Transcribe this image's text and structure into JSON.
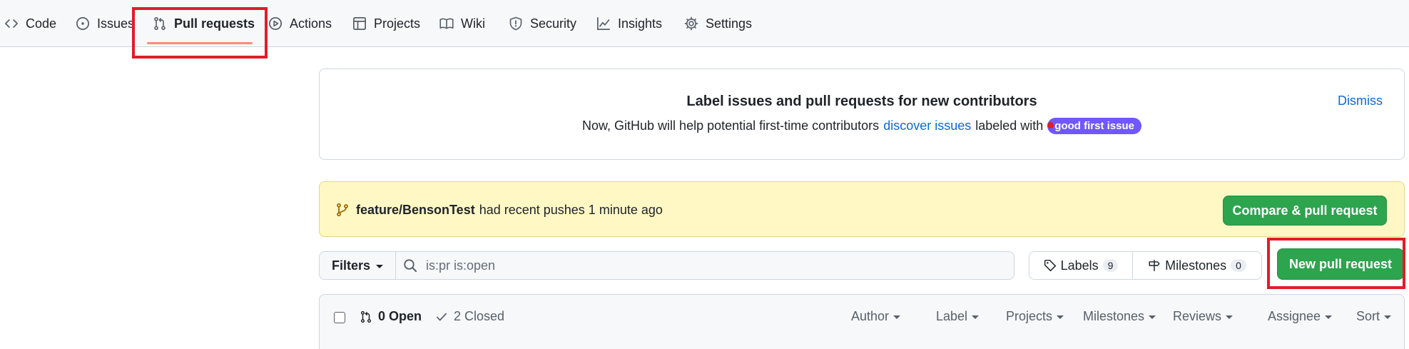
{
  "nav": {
    "items": [
      {
        "label": "Code",
        "icon": "code-icon"
      },
      {
        "label": "Issues",
        "icon": "issue-opened-icon"
      },
      {
        "label": "Pull requests",
        "icon": "git-pull-request-icon",
        "active": true
      },
      {
        "label": "Actions",
        "icon": "play-icon"
      },
      {
        "label": "Projects",
        "icon": "table-icon"
      },
      {
        "label": "Wiki",
        "icon": "book-icon"
      },
      {
        "label": "Security",
        "icon": "shield-icon"
      },
      {
        "label": "Insights",
        "icon": "graph-icon"
      },
      {
        "label": "Settings",
        "icon": "gear-icon"
      }
    ]
  },
  "onboarding": {
    "title": "Label issues and pull requests for new contributors",
    "text_before": "Now, GitHub will help potential first-time contributors",
    "link": "discover issues",
    "text_after": "labeled with",
    "label": "good first issue",
    "label_color": "#7057ff",
    "dismiss": "Dismiss"
  },
  "push": {
    "branch": "feature/BensonTest",
    "message": "had recent pushes 1 minute ago",
    "button": "Compare & pull request"
  },
  "filters": {
    "button": "Filters",
    "search_value": "is:pr is:open",
    "labels": "Labels",
    "labels_count": "9",
    "milestones": "Milestones",
    "milestones_count": "0",
    "new_pr": "New pull request"
  },
  "list_header": {
    "open": "0 Open",
    "closed": "2 Closed",
    "sorts": [
      "Author",
      "Label",
      "Projects",
      "Milestones",
      "Reviews",
      "Assignee",
      "Sort"
    ]
  },
  "colors": {
    "accent": "#0969da",
    "primary_button": "#2da44e",
    "highlight": "#e01d2a",
    "underline": "#fd8c73"
  }
}
